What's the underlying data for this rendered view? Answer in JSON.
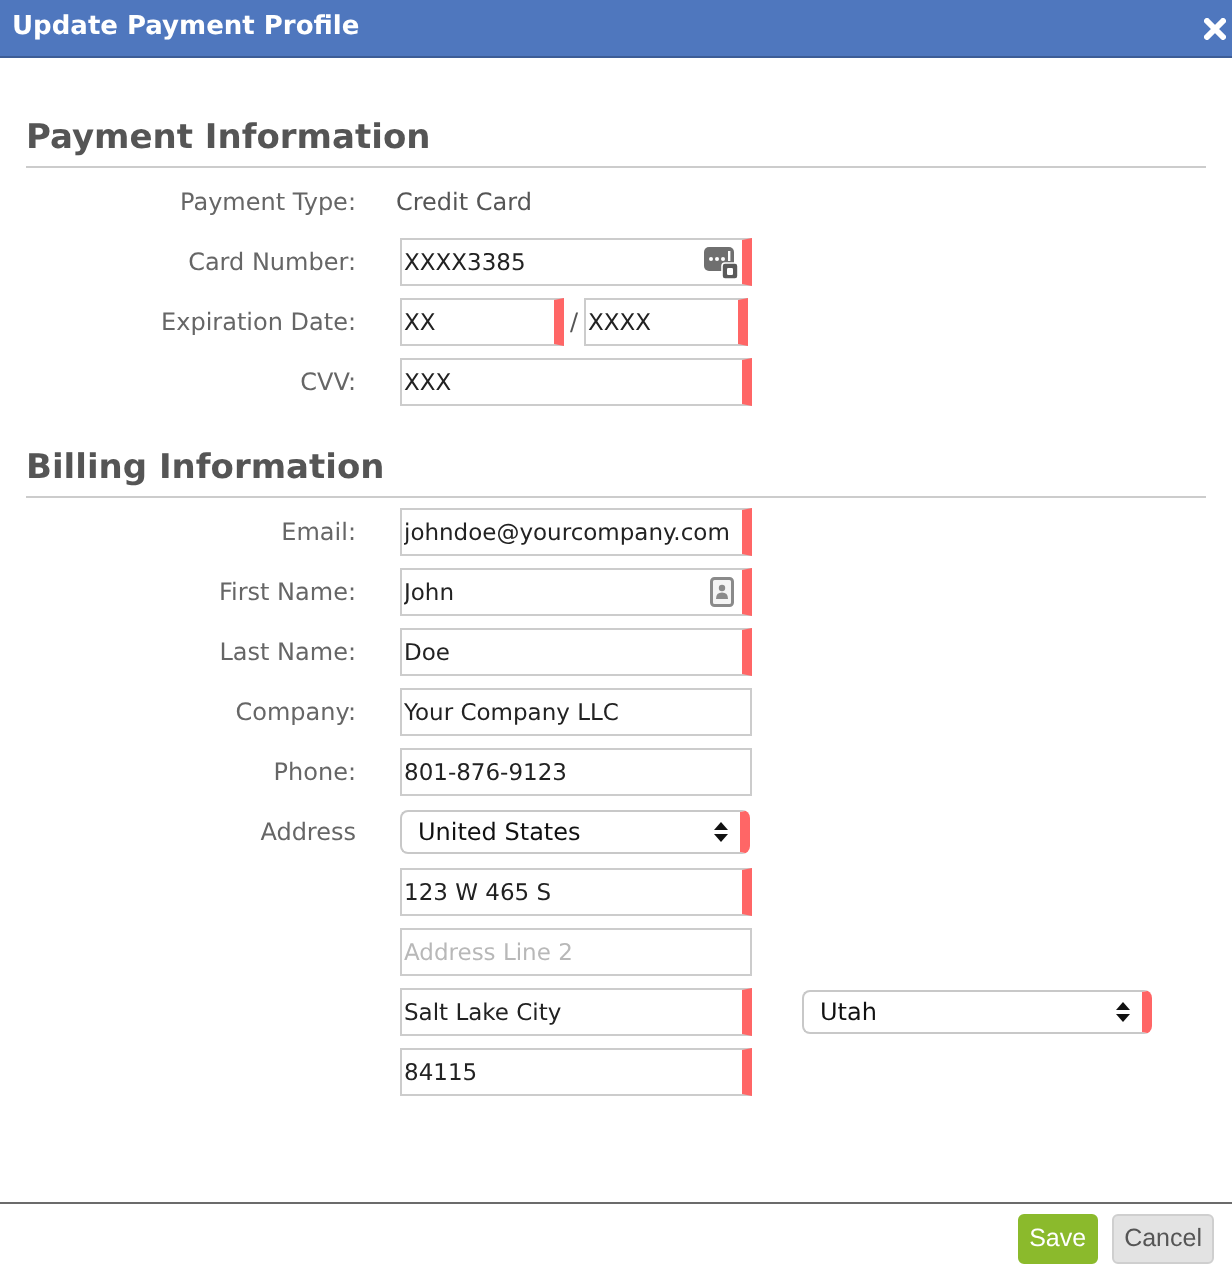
{
  "dialog": {
    "title": "Update Payment Profile"
  },
  "sections": [
    {
      "heading": "Payment Information",
      "rows": [
        {
          "label": "Payment Type:",
          "text": "Credit Card"
        },
        {
          "label": "Card Number:",
          "lines": [
            {
              "fields": [
                {
                  "kind": "card",
                  "value": "XXXX3385",
                  "required": true
                }
              ]
            }
          ]
        },
        {
          "label": "Expiration Date:",
          "lines": [
            {
              "separator": "/",
              "fields": [
                {
                  "kind": "input",
                  "value": "XX",
                  "required": true
                },
                {
                  "kind": "input",
                  "value": "XXXX",
                  "required": true
                }
              ]
            }
          ]
        },
        {
          "label": "CVV:",
          "lines": [
            {
              "fields": [
                {
                  "kind": "input",
                  "value": "XXX",
                  "required": true
                }
              ]
            }
          ]
        }
      ]
    },
    {
      "heading": "Billing Information",
      "rows": [
        {
          "label": "Email:",
          "lines": [
            {
              "fields": [
                {
                  "kind": "input",
                  "value": "johndoe@yourcompany.com",
                  "required": true
                }
              ]
            }
          ]
        },
        {
          "label": "First Name:",
          "lines": [
            {
              "fields": [
                {
                  "kind": "contact",
                  "value": "John",
                  "required": true
                }
              ]
            }
          ]
        },
        {
          "label": "Last Name:",
          "lines": [
            {
              "fields": [
                {
                  "kind": "input",
                  "value": "Doe",
                  "required": true
                }
              ]
            }
          ]
        },
        {
          "label": "Company:",
          "lines": [
            {
              "fields": [
                {
                  "kind": "input",
                  "value": "Your Company LLC",
                  "required": false
                }
              ]
            }
          ]
        },
        {
          "label": "Phone:",
          "lines": [
            {
              "fields": [
                {
                  "kind": "input",
                  "value": "801-876-9123",
                  "required": false
                }
              ]
            }
          ]
        },
        {
          "label": "Address",
          "lines": [
            {
              "fields": [
                {
                  "kind": "select",
                  "value": "United States",
                  "required": true
                }
              ]
            },
            {
              "fields": [
                {
                  "kind": "input",
                  "value": "123 W 465 S",
                  "required": true
                }
              ]
            },
            {
              "fields": [
                {
                  "kind": "input",
                  "placeholder": "Address Line 2",
                  "required": false
                }
              ]
            },
            {
              "fields": [
                {
                  "kind": "input",
                  "value": "Salt Lake City",
                  "required": true
                },
                {
                  "kind": "select",
                  "value": "Utah",
                  "required": true
                }
              ]
            },
            {
              "fields": [
                {
                  "kind": "input",
                  "value": "84115",
                  "required": true
                }
              ]
            }
          ]
        }
      ]
    }
  ],
  "buttons": [
    {
      "label": "Save",
      "kind": "primary"
    },
    {
      "label": "Cancel",
      "kind": "secondary"
    }
  ]
}
